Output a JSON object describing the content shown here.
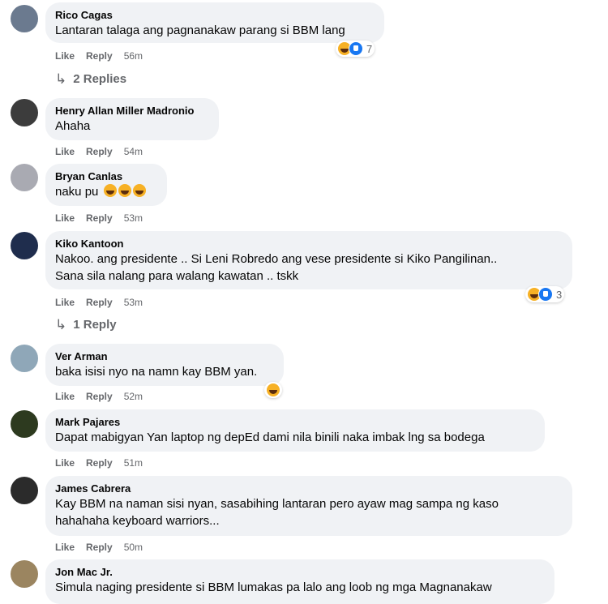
{
  "actions": {
    "like": "Like",
    "reply": "Reply"
  },
  "comments": [
    {
      "author": "Rico Cagas",
      "lines": [
        "Lantaran talaga ang pagnanakaw parang si BBM lang"
      ],
      "time": "56m",
      "reaction_count": "7",
      "replies": "2 Replies",
      "avatar_color": "#6b7a8f"
    },
    {
      "author": "Henry Allan Miller Madronio",
      "lines": [
        "Ahaha"
      ],
      "time": "54m",
      "avatar_color": "#3c3c3c"
    },
    {
      "author": "Bryan Canlas",
      "lines": [
        "naku pu"
      ],
      "time": "53m",
      "avatar_color": "#a9aab2"
    },
    {
      "author": "Kiko Kantoon",
      "lines": [
        "Nakoo. ang presidente .. Si Leni Robredo ang vese presidente si Kiko Pangilinan..",
        "Sana sila nalang para walang kawatan .. tskk"
      ],
      "time": "53m",
      "reaction_count": "3",
      "replies": "1 Reply",
      "avatar_color": "#1f2d4d"
    },
    {
      "author": "Ver Arman",
      "lines": [
        "baka isisi nyo na namn kay BBM yan."
      ],
      "time": "52m",
      "avatar_color": "#8fa7b8"
    },
    {
      "author": "Mark Pajares",
      "lines": [
        "Dapat mabigyan Yan laptop ng depEd dami nila binili naka imbak lng sa bodega"
      ],
      "time": "51m",
      "avatar_color": "#2d3a1f"
    },
    {
      "author": "James Cabrera",
      "lines": [
        "Kay BBM na naman sisi nyan, sasabihing lantaran pero ayaw mag sampa ng kaso",
        "hahahaha keyboard warriors..."
      ],
      "time": "50m",
      "avatar_color": "#2b2b2b"
    },
    {
      "author": "Jon Mac Jr.",
      "lines": [
        "Simula naging presidente si BBM lumakas pa lalo ang loob ng mga Magnanakaw"
      ],
      "time": "",
      "avatar_color": "#9b8560"
    }
  ]
}
